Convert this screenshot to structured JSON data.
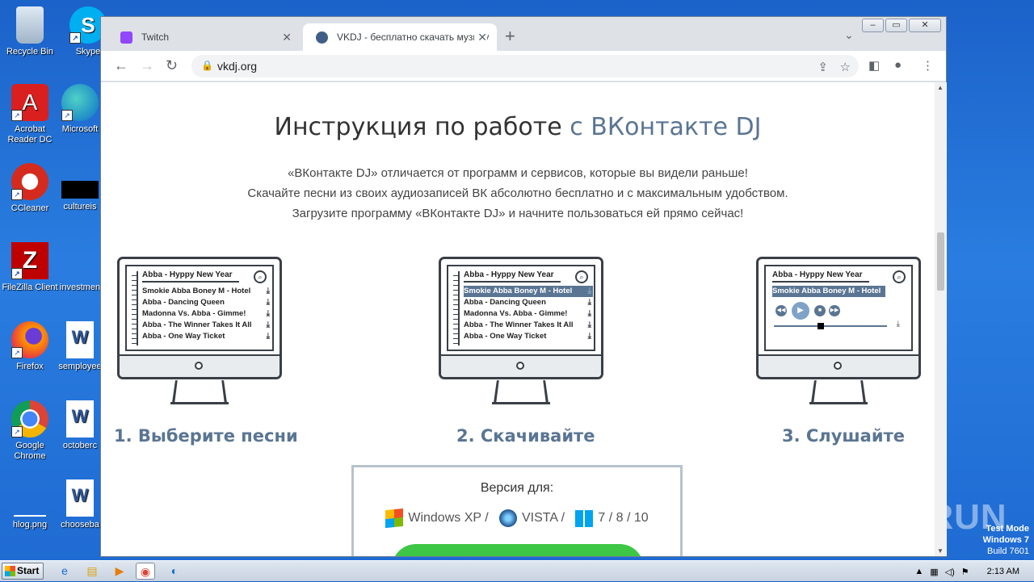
{
  "desktop": {
    "icons": [
      {
        "label": "Recycle Bin"
      },
      {
        "label": "Skype"
      },
      {
        "label": "Acrobat Reader DC"
      },
      {
        "label": "Microsoft"
      },
      {
        "label": "CCleaner"
      },
      {
        "label": "cultureis"
      },
      {
        "label": "FileZilla Client"
      },
      {
        "label": "investmen"
      },
      {
        "label": "Firefox"
      },
      {
        "label": "semployee"
      },
      {
        "label": "Google Chrome"
      },
      {
        "label": "octoberc"
      },
      {
        "label": "hlog.png"
      },
      {
        "label": "chooseba"
      }
    ],
    "watermark": "ANY RUN",
    "test_mode": {
      "line1": "Test Mode",
      "line2": "Windows 7",
      "line3": "Build 7601"
    }
  },
  "browser": {
    "tabs": [
      {
        "title": "Twitch",
        "favicon": "twitch-icon",
        "color": "#9146ff"
      },
      {
        "title": "VKDJ - бесплатно скачать музыку",
        "favicon": "vkdj-icon",
        "color": "#3f5f86"
      }
    ],
    "url": "vkdj.org"
  },
  "page": {
    "title_main": "Инструкция по работе ",
    "title_accent": "с ВКонтакте DJ",
    "intro": [
      "«ВКонтакте DJ» отличается от программ и сервисов, которые вы видели раньше!",
      "Скачайте песни из своих аудиозаписей ВК абсолютно бесплатно и с максимальным удобством.",
      "Загрузите программу «ВКонтакте DJ» и начните пользоваться ей прямо сейчас!"
    ],
    "steps": [
      {
        "label": "1. Выберите песни",
        "playlist_title": "Abba - Hyppy New Year",
        "tracks": [
          "Smokie Abba Boney M - Hotel",
          "Abba - Dancing Queen",
          "Madonna Vs. Abba - Gimme!",
          "Abba - The Winner Takes It All",
          "Abba - One Way Ticket"
        ]
      },
      {
        "label": "2. Скачивайте",
        "playlist_title": "Abba - Hyppy New Year",
        "tracks": [
          "Smokie Abba Boney M - Hotel",
          "Abba - Dancing Queen",
          "Madonna Vs. Abba - Gimme!",
          "Abba - The Winner Takes It All",
          "Abba - One Way Ticket"
        ]
      },
      {
        "label": "3. Слушайте",
        "playlist_title": "Abba - Hyppy New Year",
        "tracks": [
          "Smokie Abba Boney M - Hotel"
        ]
      }
    ],
    "version": {
      "title": "Версия для:",
      "os": [
        "Windows XP /",
        "VISTA /",
        "7 / 8 / 10"
      ]
    },
    "accent_color": "#5a7593",
    "button_color": "#3ec646"
  },
  "taskbar": {
    "start_label": "Start",
    "clock": "2:13 AM"
  }
}
